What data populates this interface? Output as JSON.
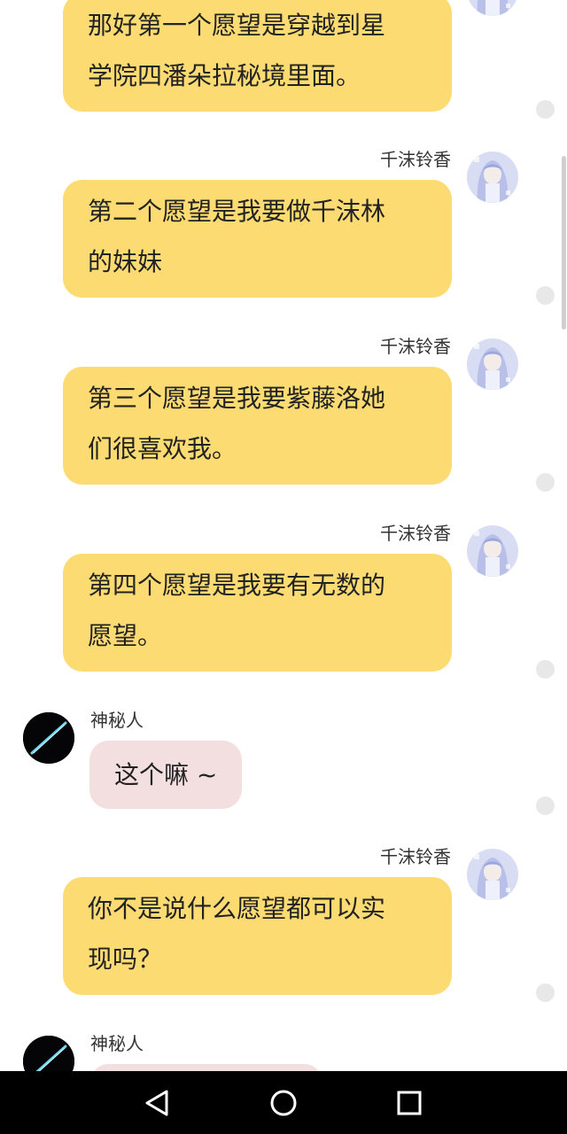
{
  "messages": [
    {
      "side": "right",
      "sender": "",
      "text": "那好第一个愿望是穿越到星\n学院四潘朵拉秘境里面。"
    },
    {
      "side": "right",
      "sender": "千沫铃香",
      "text": "第二个愿望是我要做千沫林\n的妹妹"
    },
    {
      "side": "right",
      "sender": "千沫铃香",
      "text": "第三个愿望是我要紫藤洛她\n们很喜欢我。"
    },
    {
      "side": "right",
      "sender": "千沫铃香",
      "text": "第四个愿望是我要有无数的\n愿望。"
    },
    {
      "side": "left",
      "sender": "神秘人",
      "text": "这个嘛 ~"
    },
    {
      "side": "right",
      "sender": "千沫铃香",
      "text": "你不是说什么愿望都可以实\n现吗？"
    },
    {
      "side": "left",
      "sender": "神秘人",
      "text": ""
    }
  ],
  "colors": {
    "right_bubble": "#fbdb72",
    "left_bubble": "#f4dfe0",
    "navbar": "#000000"
  },
  "icons": {
    "right_avatar": "anime-girl-avatar",
    "left_avatar": "dark-slash-avatar",
    "nav_back": "triangle-back-icon",
    "nav_home": "circle-home-icon",
    "nav_recent": "square-recent-icon"
  }
}
